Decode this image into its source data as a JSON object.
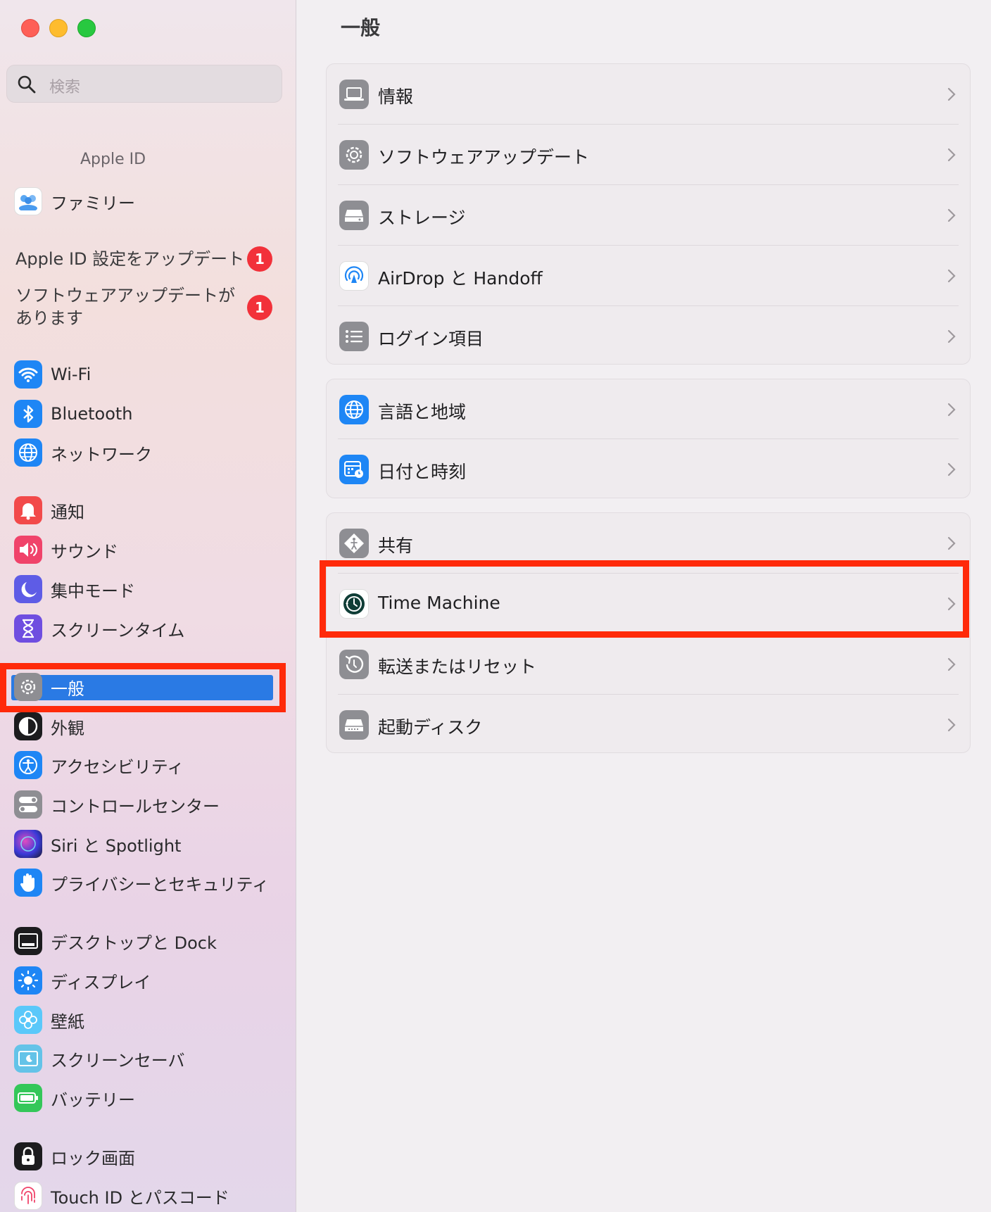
{
  "window": {
    "controls": [
      "close",
      "minimize",
      "zoom"
    ]
  },
  "sidebar": {
    "search_placeholder": "検索",
    "apple_id_label": "Apple ID",
    "family_label": "ファミリー",
    "notices": [
      {
        "text": "Apple ID 設定をアップデート",
        "badge": "1"
      },
      {
        "text_line1": "ソフトウェアアップデートが",
        "text_line2": "あります",
        "badge": "1"
      }
    ],
    "items": [
      {
        "label": "Wi-Fi",
        "icon": "wifi-icon"
      },
      {
        "label": "Bluetooth",
        "icon": "bluetooth-icon"
      },
      {
        "label": "ネットワーク",
        "icon": "globe-icon"
      },
      {
        "label": "通知",
        "icon": "bell-icon"
      },
      {
        "label": "サウンド",
        "icon": "speaker-icon"
      },
      {
        "label": "集中モード",
        "icon": "moon-icon"
      },
      {
        "label": "スクリーンタイム",
        "icon": "hourglass-icon"
      },
      {
        "label": "一般",
        "icon": "gear-icon",
        "selected": true
      },
      {
        "label": "外観",
        "icon": "appearance-icon"
      },
      {
        "label": "アクセシビリティ",
        "icon": "accessibility-icon"
      },
      {
        "label": "コントロールセンター",
        "icon": "toggles-icon"
      },
      {
        "label": "Siri と Spotlight",
        "icon": "siri-icon"
      },
      {
        "label": "プライバシーとセキュリティ",
        "icon": "hand-icon"
      },
      {
        "label": "デスクトップと Dock",
        "icon": "dock-icon"
      },
      {
        "label": "ディスプレイ",
        "icon": "sun-icon"
      },
      {
        "label": "壁紙",
        "icon": "flower-icon"
      },
      {
        "label": "スクリーンセーバ",
        "icon": "screensaver-icon"
      },
      {
        "label": "バッテリー",
        "icon": "battery-icon"
      },
      {
        "label": "ロック画面",
        "icon": "lock-icon"
      },
      {
        "label": "Touch ID とパスコード",
        "icon": "fingerprint-icon"
      }
    ]
  },
  "main": {
    "title": "一般",
    "groups": [
      {
        "rows": [
          {
            "label": "情報",
            "icon": "laptop-icon"
          },
          {
            "label": "ソフトウェアアップデート",
            "icon": "gear-badge-icon"
          },
          {
            "label": "ストレージ",
            "icon": "drive-icon"
          },
          {
            "label": "AirDrop と Handoff",
            "icon": "airdrop-icon"
          },
          {
            "label": "ログイン項目",
            "icon": "list-icon"
          }
        ]
      },
      {
        "rows": [
          {
            "label": "言語と地域",
            "icon": "globe-icon"
          },
          {
            "label": "日付と時刻",
            "icon": "calendar-clock-icon"
          }
        ]
      },
      {
        "rows": [
          {
            "label": "共有",
            "icon": "sharing-icon"
          },
          {
            "label": "Time Machine",
            "icon": "time-machine-icon",
            "highlighted": true
          },
          {
            "label": "転送またはリセット",
            "icon": "reset-icon"
          },
          {
            "label": "起動ディスク",
            "icon": "startup-disk-icon"
          }
        ]
      }
    ]
  },
  "colors": {
    "selection": "#2a7ae4",
    "highlight_border": "#ff2a0a",
    "badge": "#f2313a"
  }
}
